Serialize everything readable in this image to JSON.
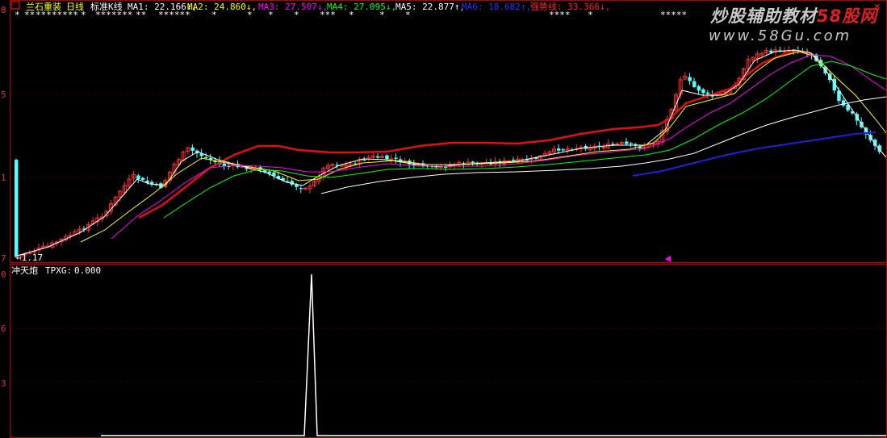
{
  "header": {
    "stock_name": "兰石重装",
    "period": "日线",
    "mode": "标准K线",
    "indicators": [
      {
        "name": "MA1:",
        "value": "22.166",
        "arrow": "↓",
        "color": "#ffffff"
      },
      {
        "name": "MA2:",
        "value": "24.860",
        "arrow": "↓",
        "color": "#ffff00"
      },
      {
        "name": "MA3:",
        "value": "27.507",
        "arrow": "↓",
        "color": "#ff00ff"
      },
      {
        "name": "MA4:",
        "value": "27.095",
        "arrow": "↓",
        "color": "#00ff00"
      },
      {
        "name": "MA5:",
        "value": "22.877",
        "arrow": "↑",
        "color": "#ffffff"
      },
      {
        "name": "MA6:",
        "value": "18.682",
        "arrow": "↑",
        "color": "#3030ff"
      },
      {
        "name": "强势线:",
        "value": "33.366",
        "arrow": "↓",
        "color": "#ff2020"
      }
    ],
    "minimize_icon": "minimize-icon",
    "close_icon": "close-icon",
    "close_symbol": "×"
  },
  "price_axis": {
    "labels": [
      "8",
      "5",
      "1",
      "7"
    ]
  },
  "low_marker": "←1.17",
  "sub_panel": {
    "title": "冲天炮",
    "indicator_name": "TPXG:",
    "indicator_value": "0.000",
    "axis_labels": [
      "0",
      "6",
      "3"
    ]
  },
  "watermark": {
    "line1": "炒股辅助教材",
    "line1_brand": "58股网",
    "line2": "www.58Gu.com"
  },
  "colors": {
    "up_candle": "#ff3030",
    "down_candle": "#54ffff",
    "strong_line": "#e01010",
    "ma1": "#ffffff",
    "ma2": "#ffff00",
    "ma3": "#ff00ff",
    "ma4": "#00ff00",
    "ma6": "#2020dd",
    "frame": "#b00000",
    "watermark": "#c8c8c8",
    "watermark_brand": "#e02020"
  },
  "chart_data": {
    "type": "candlestick",
    "title": "兰石重装 日线",
    "price_axis_labels": [
      "8",
      "5",
      "1",
      "7"
    ],
    "low_marker": "1.17",
    "series": [
      {
        "name": "MA1",
        "value": 22.166
      },
      {
        "name": "MA2",
        "value": 24.86
      },
      {
        "name": "MA3",
        "value": 27.507
      },
      {
        "name": "MA4",
        "value": 27.095
      },
      {
        "name": "MA5",
        "value": 22.877
      },
      {
        "name": "MA6",
        "value": 18.682
      },
      {
        "name": "强势线",
        "value": 33.366
      }
    ],
    "sub_indicator": {
      "name": "TPXG",
      "value": 0.0,
      "peak": 1,
      "axis_labels": [
        "0",
        "6",
        "3"
      ]
    }
  }
}
